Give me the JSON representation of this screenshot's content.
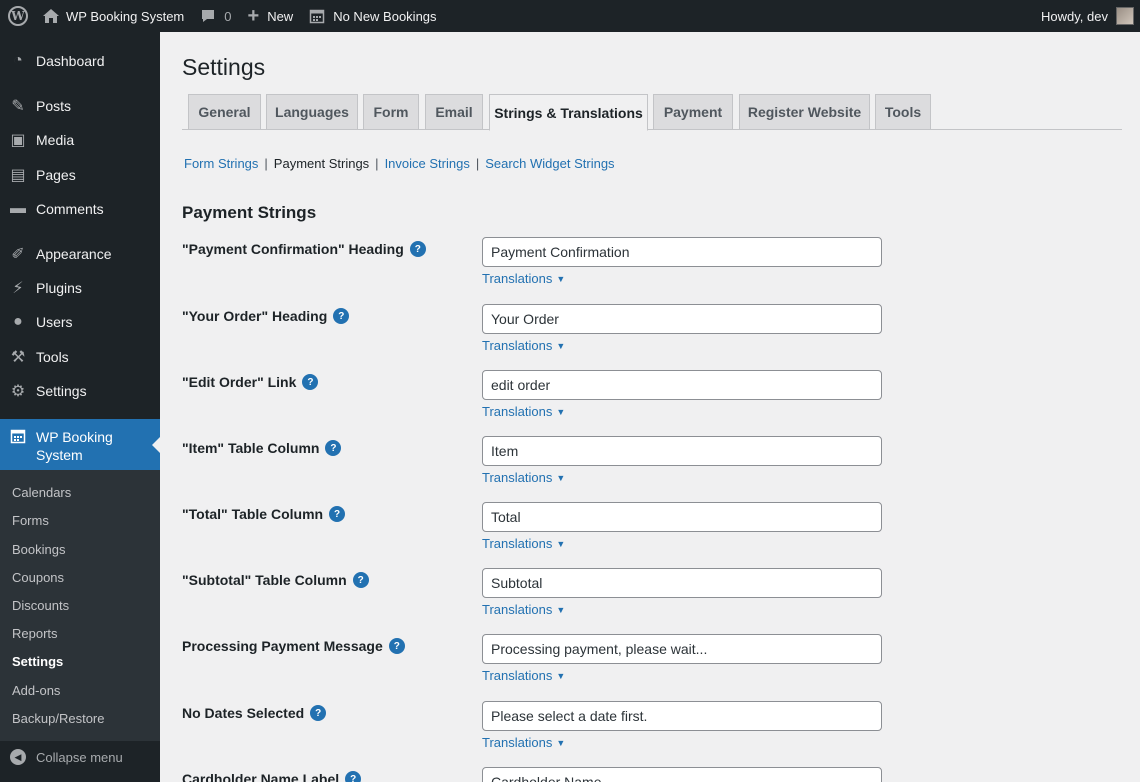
{
  "adminbar": {
    "site_name": "WP Booking System",
    "comments_count": "0",
    "new_label": "New",
    "bookings_label": "No New Bookings",
    "howdy": "Howdy, dev"
  },
  "sidebar": {
    "items": [
      {
        "label": "Dashboard",
        "icon": "dashboard-icon",
        "glyph": "◔"
      },
      {
        "label": "Posts",
        "icon": "pushpin-icon",
        "glyph": "✎"
      },
      {
        "label": "Media",
        "icon": "media-icon",
        "glyph": "▣"
      },
      {
        "label": "Pages",
        "icon": "pages-icon",
        "glyph": "▤"
      },
      {
        "label": "Comments",
        "icon": "comment-icon",
        "glyph": "▬"
      },
      {
        "label": "Appearance",
        "icon": "brush-icon",
        "glyph": "✐"
      },
      {
        "label": "Plugins",
        "icon": "plugin-icon",
        "glyph": "⚡"
      },
      {
        "label": "Users",
        "icon": "user-icon",
        "glyph": "●"
      },
      {
        "label": "Tools",
        "icon": "wrench-icon",
        "glyph": "⚒"
      },
      {
        "label": "Settings",
        "icon": "settings-icon",
        "glyph": "⚙"
      }
    ],
    "current": {
      "label_line1": "WP Booking",
      "label_line2": "System",
      "icon": "calendar-icon"
    },
    "submenu": [
      "Calendars",
      "Forms",
      "Bookings",
      "Coupons",
      "Discounts",
      "Reports",
      "Settings",
      "Add-ons",
      "Backup/Restore"
    ],
    "submenu_current": "Settings",
    "collapse_label": "Collapse menu"
  },
  "page": {
    "title": "Settings",
    "tabs": [
      "General",
      "Languages",
      "Form",
      "Email",
      "Strings & Translations",
      "Payment",
      "Register Website",
      "Tools"
    ],
    "active_tab": "Strings & Translations",
    "subsub": [
      "Form Strings",
      "Payment Strings",
      "Invoice Strings",
      "Search Widget Strings"
    ],
    "subsub_current": "Payment Strings",
    "section_title": "Payment Strings",
    "translations_label": "Translations",
    "rows": [
      {
        "label": "\"Payment Confirmation\" Heading",
        "value": "Payment Confirmation"
      },
      {
        "label": "\"Your Order\" Heading",
        "value": "Your Order"
      },
      {
        "label": "\"Edit Order\" Link",
        "value": "edit order"
      },
      {
        "label": "\"Item\" Table Column",
        "value": "Item"
      },
      {
        "label": "\"Total\" Table Column",
        "value": "Total"
      },
      {
        "label": "\"Subtotal\" Table Column",
        "value": "Subtotal"
      },
      {
        "label": "Processing Payment Message",
        "value": "Processing payment, please wait..."
      },
      {
        "label": "No Dates Selected",
        "value": "Please select a date first."
      },
      {
        "label": "Cardholder Name Label",
        "value": "Cardholder Name"
      }
    ]
  }
}
